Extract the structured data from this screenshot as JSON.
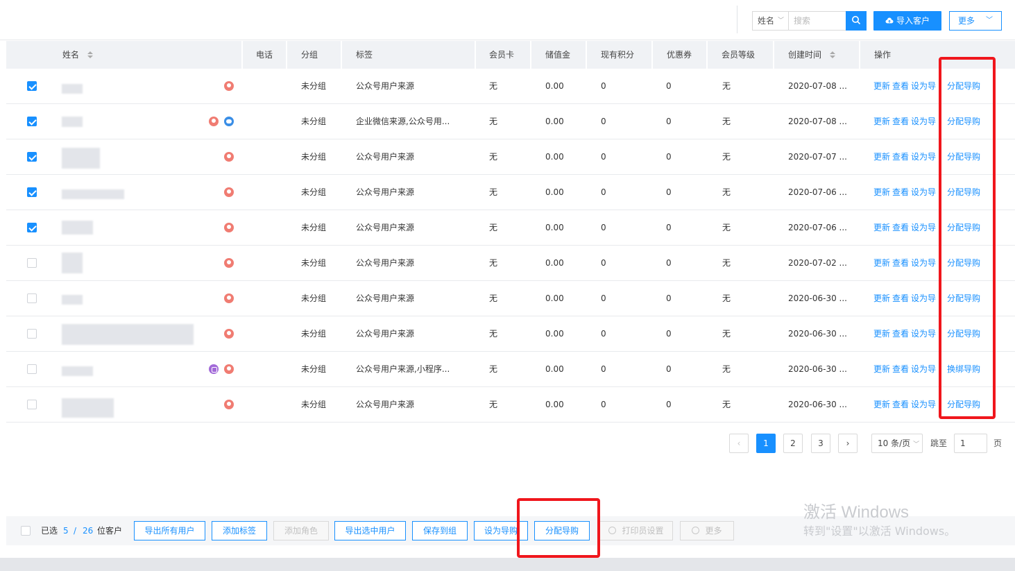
{
  "toolbar": {
    "field_select": "姓名",
    "search_placeholder": "搜索",
    "import_label": "导入客户",
    "more_label": "更多"
  },
  "table": {
    "headers": {
      "name": "姓名",
      "phone": "电话",
      "group": "分组",
      "tags": "标签",
      "card": "会员卡",
      "balance": "储值金",
      "points": "现有积分",
      "coupon": "优惠券",
      "level": "会员等级",
      "created": "创建时间",
      "ops": "操作"
    },
    "op_labels": {
      "update": "更新",
      "view": "查看",
      "set_guide": "设为导购"
    },
    "rows": [
      {
        "checked": true,
        "icons": [
          "user"
        ],
        "group": "未分组",
        "tags": "公众号用户来源",
        "card": "无",
        "balance": "0.00",
        "points": "0",
        "coupon": "0",
        "level": "无",
        "created": "2020-07-08 ...",
        "assign": "分配导购"
      },
      {
        "checked": true,
        "icons": [
          "user",
          "wechat"
        ],
        "group": "未分组",
        "tags": "企业微信来源,公众号用...",
        "card": "无",
        "balance": "0.00",
        "points": "0",
        "coupon": "0",
        "level": "无",
        "created": "2020-07-08 ...",
        "assign": "分配导购"
      },
      {
        "checked": true,
        "icons": [
          "user"
        ],
        "group": "未分组",
        "tags": "公众号用户来源",
        "card": "无",
        "balance": "0.00",
        "points": "0",
        "coupon": "0",
        "level": "无",
        "created": "2020-07-07 ...",
        "assign": "分配导购"
      },
      {
        "checked": true,
        "icons": [
          "user"
        ],
        "group": "未分组",
        "tags": "公众号用户来源",
        "card": "无",
        "balance": "0.00",
        "points": "0",
        "coupon": "0",
        "level": "无",
        "created": "2020-07-06 ...",
        "assign": "分配导购"
      },
      {
        "checked": true,
        "icons": [
          "user"
        ],
        "group": "未分组",
        "tags": "公众号用户来源",
        "card": "无",
        "balance": "0.00",
        "points": "0",
        "coupon": "0",
        "level": "无",
        "created": "2020-07-06 ...",
        "assign": "分配导购"
      },
      {
        "checked": false,
        "icons": [
          "user"
        ],
        "group": "未分组",
        "tags": "公众号用户来源",
        "card": "无",
        "balance": "0.00",
        "points": "0",
        "coupon": "0",
        "level": "无",
        "created": "2020-07-02 ...",
        "assign": "分配导购"
      },
      {
        "checked": false,
        "icons": [
          "user"
        ],
        "group": "未分组",
        "tags": "公众号用户来源",
        "card": "无",
        "balance": "0.00",
        "points": "0",
        "coupon": "0",
        "level": "无",
        "created": "2020-06-30 ...",
        "assign": "分配导购"
      },
      {
        "checked": false,
        "icons": [
          "user"
        ],
        "group": "未分组",
        "tags": "公众号用户来源",
        "card": "无",
        "balance": "0.00",
        "points": "0",
        "coupon": "0",
        "level": "无",
        "created": "2020-06-30 ...",
        "assign": "分配导购"
      },
      {
        "checked": false,
        "icons": [
          "link",
          "user"
        ],
        "group": "未分组",
        "tags": "公众号用户来源,小程序...",
        "card": "无",
        "balance": "0.00",
        "points": "0",
        "coupon": "0",
        "level": "无",
        "created": "2020-06-30 ...",
        "assign": "换绑导购"
      },
      {
        "checked": false,
        "icons": [
          "user"
        ],
        "group": "未分组",
        "tags": "公众号用户来源",
        "card": "无",
        "balance": "0.00",
        "points": "0",
        "coupon": "0",
        "level": "无",
        "created": "2020-06-30 ...",
        "assign": "分配导购"
      }
    ]
  },
  "pagination": {
    "prev": "‹",
    "pages": [
      "1",
      "2",
      "3"
    ],
    "current_page": "1",
    "next": "›",
    "page_size": "10 条/页",
    "goto_label": "跳至",
    "goto_value": "1",
    "page_unit": "页"
  },
  "bottom": {
    "selected_label": "已选",
    "selected_count": "5",
    "separator": "/",
    "total_count": "26",
    "unit": "位客户",
    "actions": {
      "export_all": "导出所有用户",
      "add_tag": "添加标签",
      "add_role": "添加角色",
      "export_selected": "导出选中用户",
      "save_group": "保存到组",
      "set_guide": "设为导购",
      "assign_guide": "分配导购",
      "print_settings": "打印员设置",
      "more": "更多"
    }
  },
  "watermark": {
    "line1": "激活 Windows",
    "line2": "转到\"设置\"以激活 Windows。"
  },
  "colors": {
    "accent": "#1890ff",
    "highlight": "#f0161c"
  },
  "icons": {
    "search": "search-icon",
    "cloud_upload": "cloud-upload-icon",
    "user": "user-icon",
    "wechat": "wechat-icon",
    "link": "link-icon"
  }
}
